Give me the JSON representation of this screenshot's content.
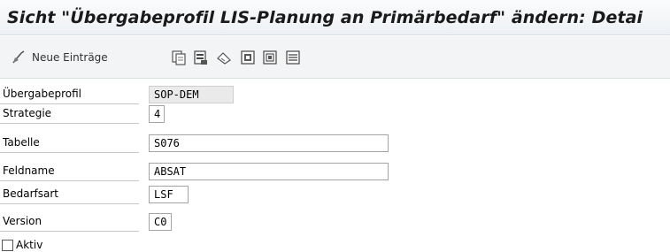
{
  "window": {
    "title": "Sicht \"Übergabeprofil LIS-Planung an Primärbedarf\" ändern: Detai"
  },
  "toolbar": {
    "new_entries_label": "Neue Einträge",
    "icons": [
      "new-entries-icon",
      "copy-icon",
      "delete-icon",
      "undo-icon",
      "select-all-icon",
      "select-block-icon",
      "deselect-all-icon"
    ]
  },
  "form": {
    "fields": [
      {
        "label": "Übergabeprofil",
        "value": "SOP-DEM",
        "readonly": true
      },
      {
        "label": "Strategie",
        "value": "4"
      },
      {
        "label": "Tabelle",
        "value": "S076"
      },
      {
        "label": "Feldname",
        "value": "ABSAT"
      },
      {
        "label": "Bedarfsart",
        "value": "LSF"
      },
      {
        "label": "Version",
        "value": "C0"
      }
    ],
    "aktiv": {
      "label": "Aktiv",
      "checked": false
    }
  }
}
